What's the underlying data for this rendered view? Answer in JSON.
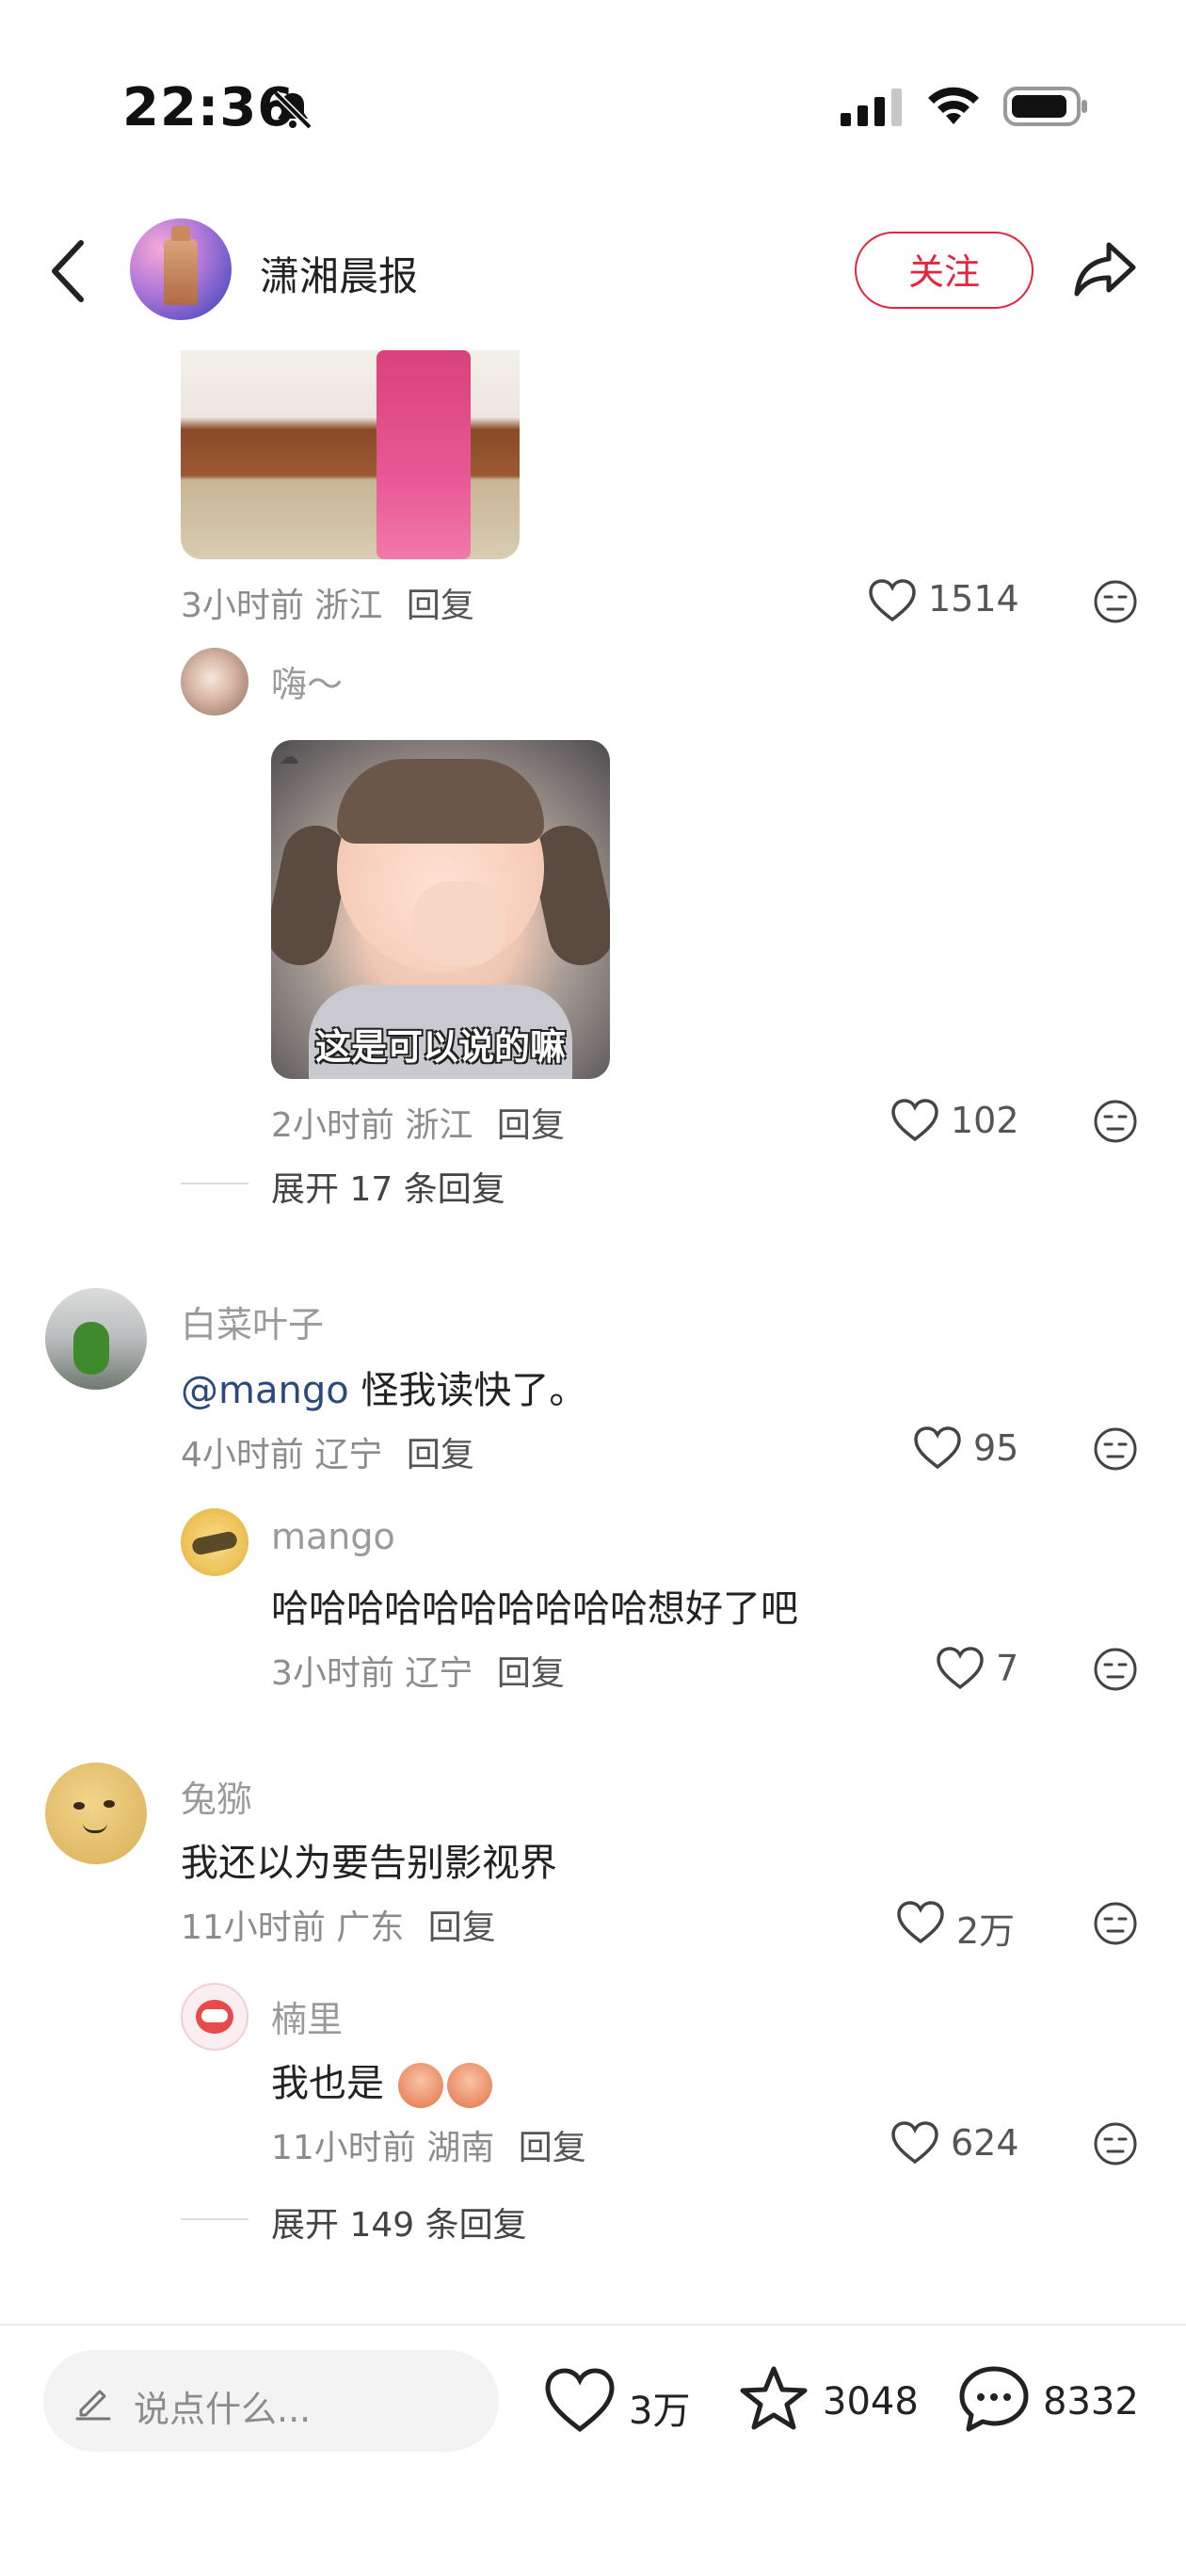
{
  "status_bar": {
    "time": "22:36"
  },
  "header": {
    "brand_name": "潇湘晨报",
    "follow_label": "关注"
  },
  "comments": [
    {
      "meta": "3小时前 浙江",
      "reply_label": "回复",
      "likes": "1514"
    },
    {
      "username": "嗨～",
      "image_caption": "这是可以说的嘛",
      "meta": "2小时前 浙江",
      "reply_label": "回复",
      "likes": "102"
    },
    {
      "expand_label": "展开 17 条回复"
    },
    {
      "username": "白菜叶子",
      "mention": "@mango",
      "text": " 怪我读快了。",
      "meta": "4小时前 辽宁",
      "reply_label": "回复",
      "likes": "95"
    },
    {
      "username": "mango",
      "text": "哈哈哈哈哈哈哈哈哈哈想好了吧",
      "meta": "3小时前 辽宁",
      "reply_label": "回复",
      "likes": "7"
    },
    {
      "username": "兔猕",
      "text": "我还以为要告别影视界",
      "meta": "11小时前 广东",
      "reply_label": "回复",
      "likes": "2万"
    },
    {
      "username": "楠里",
      "text": "我也是",
      "meta": "11小时前 湖南",
      "reply_label": "回复",
      "likes": "624"
    },
    {
      "expand_label": "展开 149 条回复"
    }
  ],
  "bottom_bar": {
    "input_placeholder": "说点什么...",
    "likes": "3万",
    "favorites": "3048",
    "comments": "8332"
  },
  "colors": {
    "accent_red": "#e6243c",
    "mention_blue": "#2a4a7c",
    "meta_gray": "#8c8c8c"
  }
}
